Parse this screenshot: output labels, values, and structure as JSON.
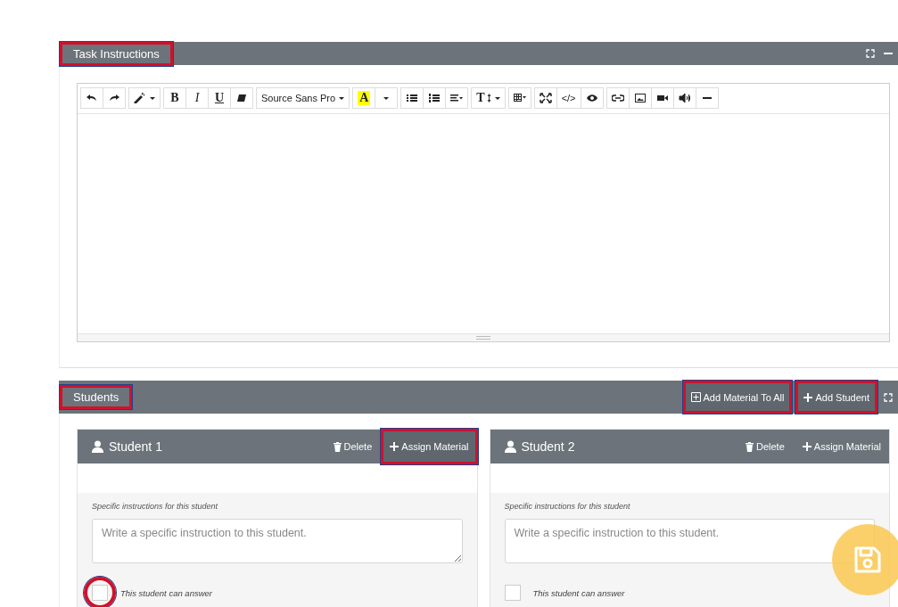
{
  "task_panel": {
    "title": "Task Instructions",
    "title_highlighted": true
  },
  "toolbar": [
    [
      {
        "kind": "undo"
      },
      {
        "kind": "redo"
      }
    ],
    [
      {
        "kind": "magic"
      }
    ],
    [
      {
        "kind": "bold",
        "label": "B"
      },
      {
        "kind": "italic",
        "label": "I"
      },
      {
        "kind": "underline",
        "label": "U"
      },
      {
        "kind": "eraser"
      }
    ],
    [
      {
        "kind": "font",
        "label": "Source Sans Pro"
      }
    ],
    [
      {
        "kind": "color",
        "label": "A"
      },
      {
        "kind": "caret"
      }
    ],
    [
      {
        "kind": "ul"
      },
      {
        "kind": "ol"
      },
      {
        "kind": "align"
      }
    ],
    [
      {
        "kind": "size",
        "label": "T"
      }
    ],
    [
      {
        "kind": "table"
      }
    ],
    [
      {
        "kind": "fullscreen"
      },
      {
        "kind": "code",
        "label": "</>"
      },
      {
        "kind": "eye"
      }
    ],
    [
      {
        "kind": "link"
      },
      {
        "kind": "image"
      },
      {
        "kind": "video"
      },
      {
        "kind": "sound"
      },
      {
        "kind": "hr"
      }
    ]
  ],
  "students_panel": {
    "title": "Students",
    "title_highlighted": true,
    "actions": [
      {
        "kind": "add-box",
        "label": "Add Material To All",
        "highlighted": true
      },
      {
        "kind": "plus",
        "label": "Add Student",
        "highlighted": true
      }
    ]
  },
  "students": [
    {
      "name": "Student 1",
      "delete_label": "Delete",
      "assign_label": "Assign Material",
      "assign_highlighted": true,
      "instructions_label": "Specific instructions for this student",
      "placeholder": "Write a specific instruction to this student.",
      "can_answer_label": "This student can answer",
      "can_answer": false,
      "checkbox_circled": true
    },
    {
      "name": "Student 2",
      "delete_label": "Delete",
      "assign_label": "Assign Material",
      "assign_highlighted": false,
      "instructions_label": "Specific instructions for this student",
      "placeholder": "Write a specific instruction to this student.",
      "can_answer_label": "This student can answer",
      "can_answer": false,
      "checkbox_circled": false
    }
  ]
}
